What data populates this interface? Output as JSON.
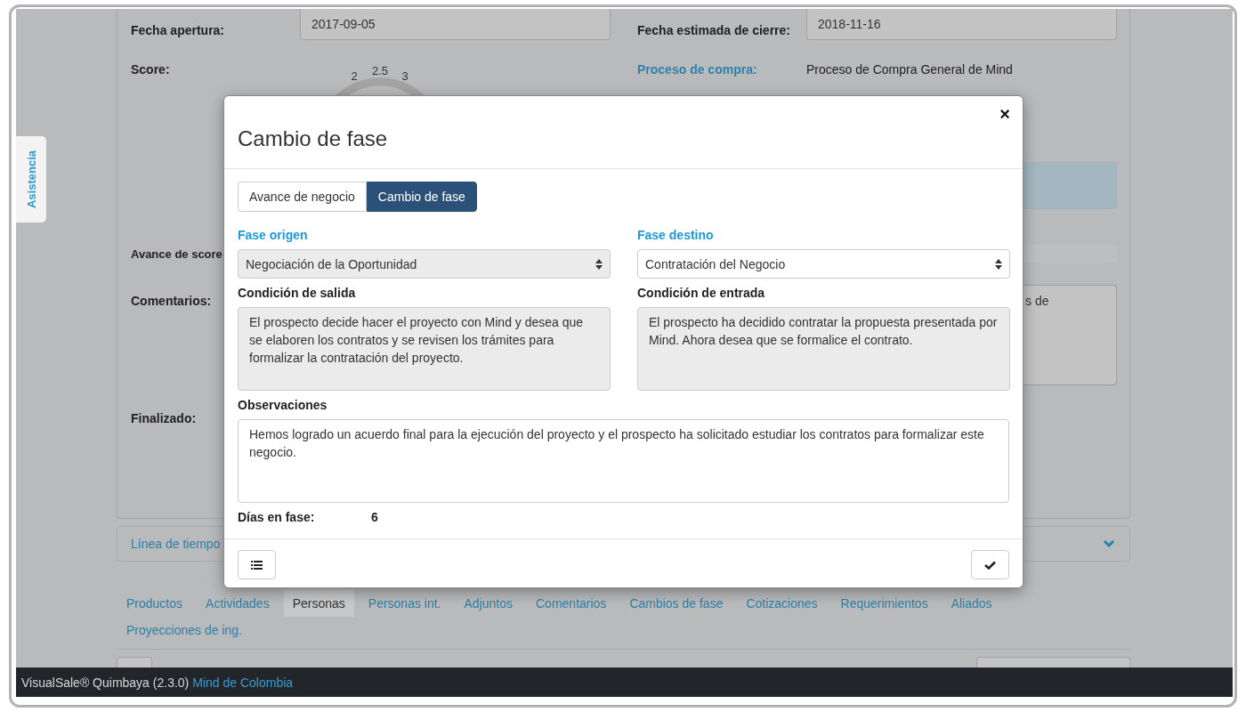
{
  "sidebar_tab": {
    "label": "Asistencia"
  },
  "details": {
    "fields": [
      {
        "label": "Fecha apertura:",
        "value": "2017-09-05"
      },
      {
        "label": "Fecha estimada de cierre:",
        "value": "2018-11-16"
      }
    ],
    "score": {
      "label": "Score:",
      "gauge_labels": [
        "2",
        "2.5",
        "3"
      ]
    },
    "purchase_process": {
      "label": "Proceso de compra:",
      "value": "Proceso de Compra General de Mind"
    },
    "score_progress": {
      "label": "Avance de score",
      "level": 0
    },
    "comments": {
      "label": "Comentarios:",
      "value": "s de"
    },
    "finished": {
      "label": "Finalizado:"
    }
  },
  "timeline": {
    "label": "Línea de tiempo",
    "expanded": false
  },
  "tabs": [
    {
      "label": "Productos",
      "selected": false
    },
    {
      "label": "Actividades",
      "selected": false
    },
    {
      "label": "Personas",
      "selected": true
    },
    {
      "label": "Personas int.",
      "selected": false
    },
    {
      "label": "Adjuntos",
      "selected": false
    },
    {
      "label": "Comentarios",
      "selected": false
    },
    {
      "label": "Cambios de fase",
      "selected": false
    },
    {
      "label": "Cotizaciones",
      "selected": false
    },
    {
      "label": "Requerimientos",
      "selected": false
    },
    {
      "label": "Aliados",
      "selected": false
    },
    {
      "label": "Proyecciones de ing.",
      "selected": false
    }
  ],
  "footer": {
    "product": "VisualSale® Quimbaya (2.3.0)",
    "company": "Mind de Colombia"
  },
  "modal": {
    "title": "Cambio de fase",
    "close": "×",
    "segments": [
      {
        "label": "Avance de negocio",
        "selected": false
      },
      {
        "label": "Cambio de fase",
        "selected": true
      }
    ],
    "origin": {
      "label": "Fase origen",
      "value": "Negociación de la Oportunidad",
      "disabled": true
    },
    "destination": {
      "label": "Fase destino",
      "value": "Contratación del Negocio",
      "disabled": false
    },
    "exit_condition": {
      "label": "Condición de salida",
      "value": "El prospecto decide hacer el proyecto con Mind y desea que se elaboren los contratos y se revisen los trámites para formalizar la contratación del proyecto."
    },
    "entry_condition": {
      "label": "Condición de entrada",
      "value": "El prospecto ha decidido contratar la propuesta presentada por Mind. Ahora desea que se formalice el contrato."
    },
    "observations": {
      "label": "Observaciones",
      "value": "Hemos logrado un acuerdo final para la ejecución del proyecto y el prospecto ha solicitado estudiar los contratos para formalizar este negocio."
    },
    "days_in_phase": {
      "label": "Días en fase:",
      "value": "6"
    }
  }
}
